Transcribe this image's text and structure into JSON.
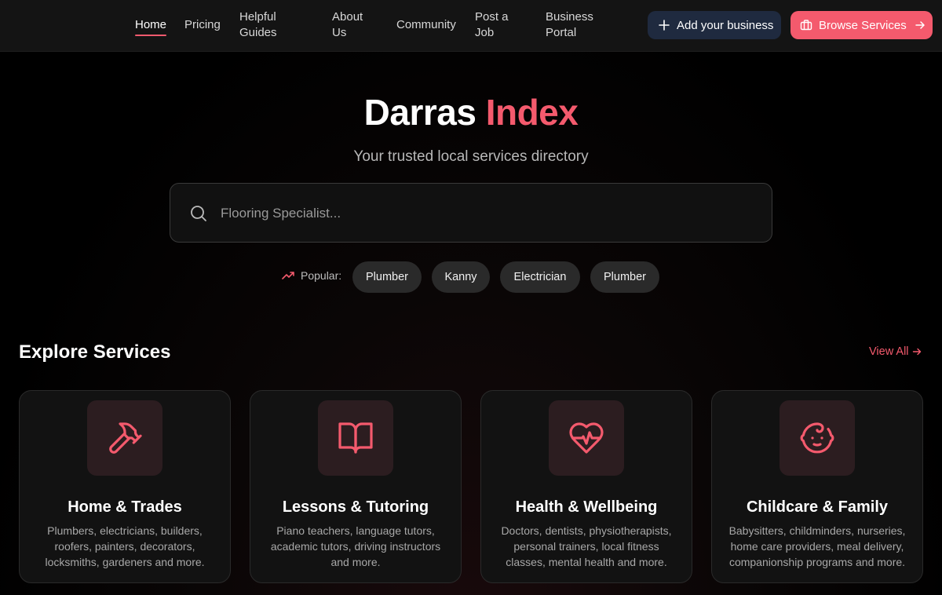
{
  "nav": {
    "links": [
      "Home",
      "Pricing",
      "Helpful Guides",
      "About Us",
      "Community",
      "Post a Job",
      "Business Portal"
    ],
    "add_business": "Add your business",
    "browse_services": "Browse Services"
  },
  "hero": {
    "title_main": "Darras",
    "title_accent": "Index",
    "subtitle": "Your trusted local services directory"
  },
  "search": {
    "placeholder": "Flooring Specialist..."
  },
  "popular": {
    "label": "Popular:",
    "chips": [
      "Plumber",
      "Kanny",
      "Electrician",
      "Plumber"
    ]
  },
  "explore": {
    "title": "Explore Services",
    "view_all": "View All",
    "cards": [
      {
        "title": "Home & Trades",
        "icon": "hammer-icon",
        "description": "Plumbers, electricians, builders, roofers, painters, decorators, locksmiths, gardeners and more."
      },
      {
        "title": "Lessons & Tutoring",
        "icon": "book-open-icon",
        "description": "Piano teachers, language tutors, academic tutors, driving instructors and more."
      },
      {
        "title": "Health & Wellbeing",
        "icon": "heart-pulse-icon",
        "description": "Doctors, dentists, physiotherapists, personal trainers, local fitness classes, mental health and more."
      },
      {
        "title": "Childcare & Family",
        "icon": "baby-icon",
        "description": "Babysitters, childminders, nurseries, home care providers, meal delivery, companionship programs and more."
      }
    ]
  },
  "colors": {
    "accent": "#f45a6d",
    "nav_bg": "#141414",
    "add_button_bg": "#1f2a3f",
    "card_bg": "#121212",
    "icon_box_bg": "#2c1d20"
  }
}
